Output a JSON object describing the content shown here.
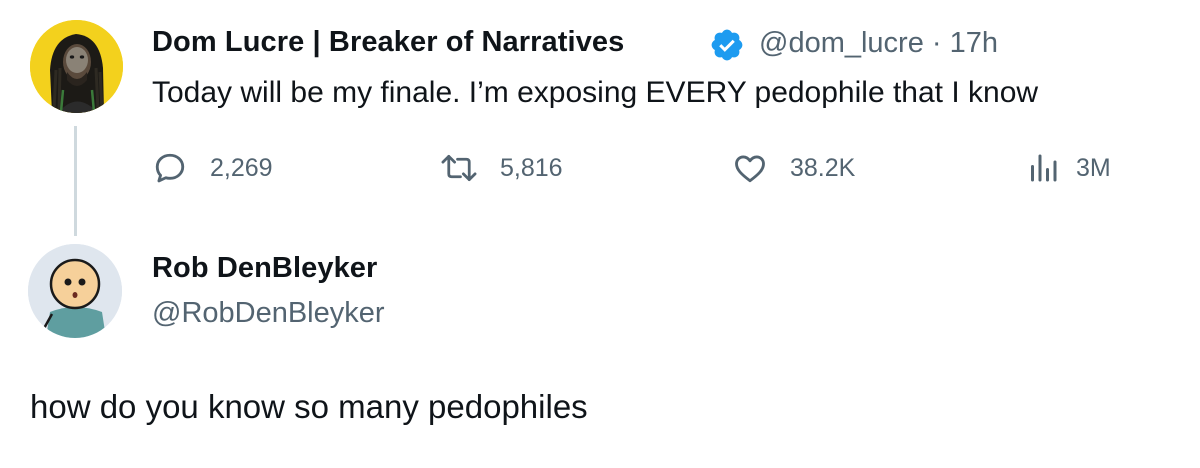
{
  "tweet": {
    "author_name": "Dom Lucre | Breaker of Narratives",
    "handle": "@dom_lucre",
    "separator": "·",
    "time": "17h",
    "text": "Today will be my finale. I’m exposing EVERY pedophile that I know",
    "verified": true,
    "avatar_icon": "dom-lucre-avatar",
    "stats": {
      "replies": "2,269",
      "retweets": "5,816",
      "likes": "38.2K",
      "views": "3M"
    }
  },
  "reply": {
    "author_name": "Rob DenBleyker",
    "handle": "@RobDenBleyker",
    "text": "how do you know so many pedophiles",
    "avatar_icon": "cyanide-happiness-avatar"
  },
  "colors": {
    "text": "#0f1419",
    "secondary": "#536471",
    "verified_blue": "#1d9bf0",
    "thread_line": "#cfd9de",
    "avatar_yellow": "#f3d11d"
  }
}
